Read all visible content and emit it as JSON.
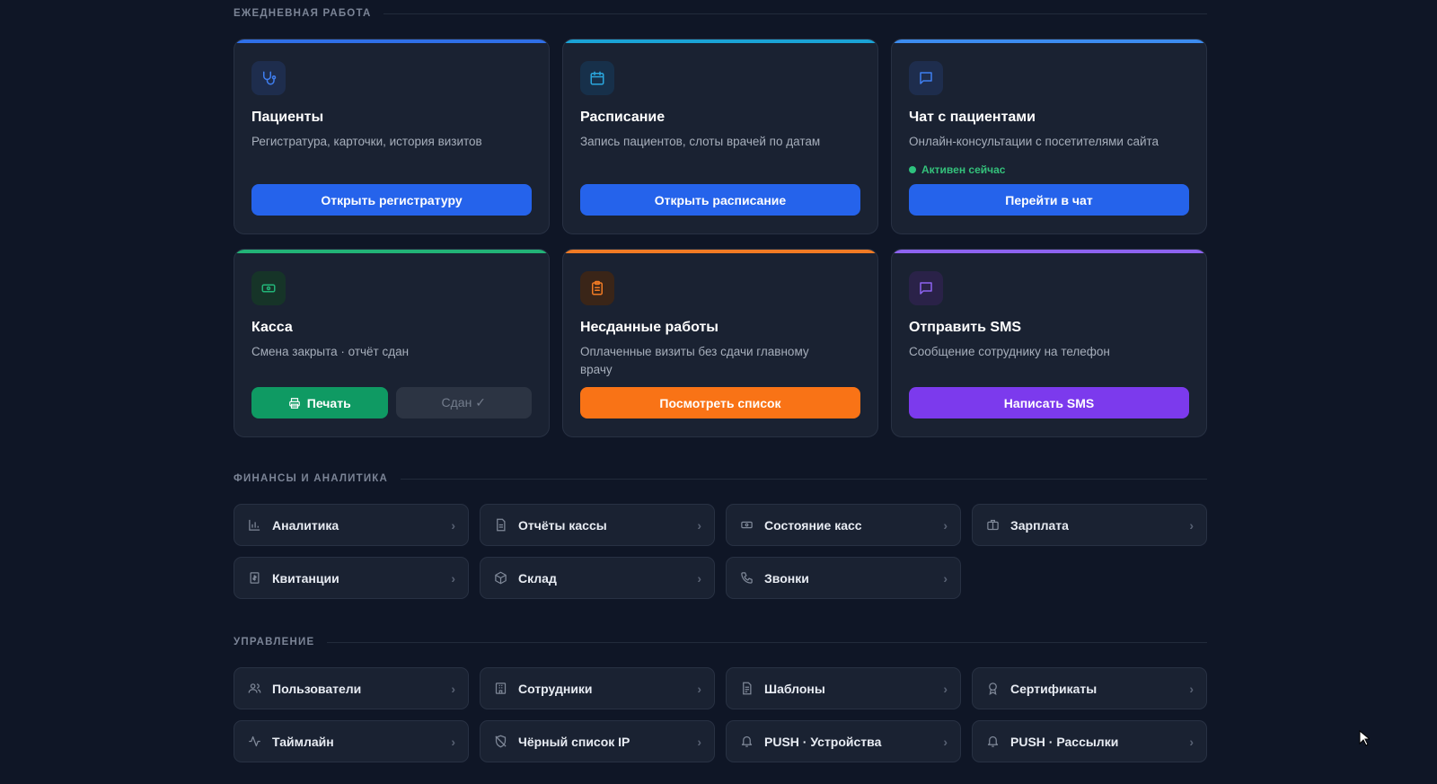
{
  "sections": {
    "daily": "ЕЖЕДНЕВНАЯ РАБОТА",
    "finance": "ФИНАНСЫ И АНАЛИТИКА",
    "management": "УПРАВЛЕНИЕ"
  },
  "cards": [
    {
      "title": "Пациенты",
      "desc": "Регистратура, карточки, история визитов",
      "button": "Открыть регистратуру",
      "accent": "#2f6fe8",
      "icon": "stethoscope-icon"
    },
    {
      "title": "Расписание",
      "desc": "Запись пациентов, слоты врачей по датам",
      "button": "Открыть расписание",
      "accent": "#1aa3d6",
      "icon": "calendar-icon"
    },
    {
      "title": "Чат с пациентами",
      "desc": "Онлайн-консультации с посетителями сайта",
      "status": "Активен сейчас",
      "button": "Перейти в чат",
      "accent": "#3c8cf0",
      "icon": "chat-icon"
    },
    {
      "title": "Касса",
      "desc": "Смена закрыта · отчёт сдан",
      "button": "Печать",
      "button2": "Сдан ✓",
      "accent": "#22b377",
      "icon": "cash-icon"
    },
    {
      "title": "Несданные работы",
      "desc": "Оплаченные визиты без сдачи главному врачу",
      "button": "Посмотреть список",
      "accent": "#f07a24",
      "icon": "clipboard-icon"
    },
    {
      "title": "Отправить SMS",
      "desc": "Сообщение сотруднику на телефон",
      "button": "Написать SMS",
      "accent": "#8d63f0",
      "icon": "message-icon"
    }
  ],
  "finance_items": [
    {
      "label": "Аналитика",
      "icon": "bar-chart-icon"
    },
    {
      "label": "Отчёты кассы",
      "icon": "document-icon"
    },
    {
      "label": "Состояние касс",
      "icon": "cash-icon"
    },
    {
      "label": "Зарплата",
      "icon": "briefcase-icon"
    },
    {
      "label": "Квитанции",
      "icon": "receipt-icon"
    },
    {
      "label": "Склад",
      "icon": "box-icon"
    },
    {
      "label": "Звонки",
      "icon": "phone-icon"
    }
  ],
  "management_items": [
    {
      "label": "Пользователи",
      "icon": "users-icon"
    },
    {
      "label": "Сотрудники",
      "icon": "building-icon"
    },
    {
      "label": "Шаблоны",
      "icon": "template-icon"
    },
    {
      "label": "Сертификаты",
      "icon": "award-icon"
    },
    {
      "label": "Таймлайн",
      "icon": "activity-icon"
    },
    {
      "label": "Чёрный список IP",
      "icon": "shield-off-icon"
    },
    {
      "label": "PUSH · Устройства",
      "icon": "bell-icon"
    },
    {
      "label": "PUSH · Рассылки",
      "icon": "bell-icon"
    }
  ],
  "chevron": "›"
}
